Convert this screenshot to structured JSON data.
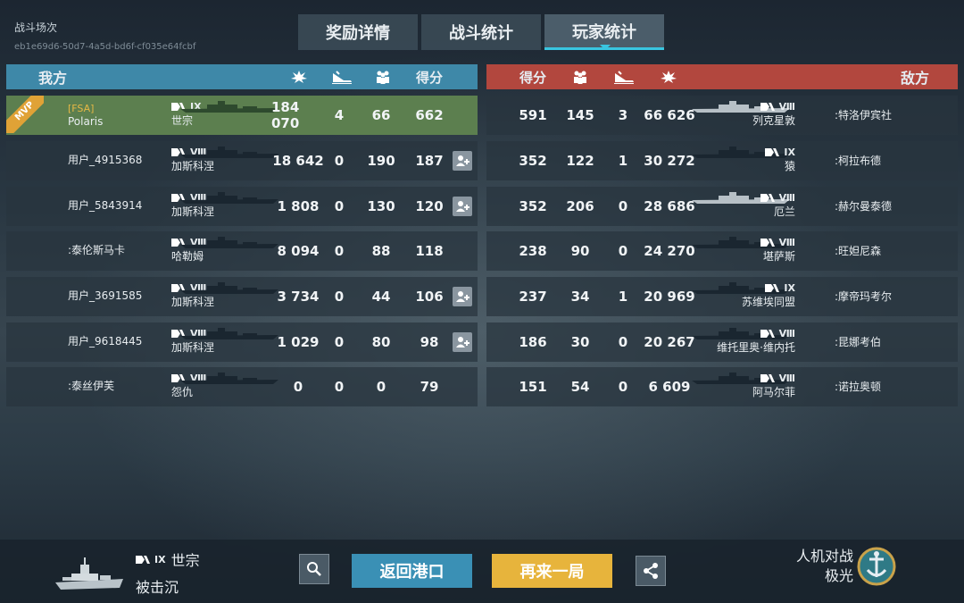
{
  "header": {
    "battle_label": "战斗场次",
    "battle_id": "eb1e69d6-50d7-4a5d-bd6f-cf035e64fcbf"
  },
  "tabs": [
    {
      "label": "奖励详情",
      "active": false
    },
    {
      "label": "战斗统计",
      "active": false
    },
    {
      "label": "玩家统计",
      "active": true
    }
  ],
  "ally": {
    "title": "我方",
    "score_header": "得分",
    "rows": [
      {
        "clan": "[FSA]",
        "name": "Polaris",
        "tier": "IX",
        "ship": "世宗",
        "damage": "184 070",
        "kills": "4",
        "xp": "66",
        "score": "662",
        "mvp": true,
        "mvp_label": "MVP",
        "add_friend": false
      },
      {
        "clan": "",
        "name": "用户_4915368",
        "tier": "Ⅷ",
        "ship": "加斯科涅",
        "damage": "18 642",
        "kills": "0",
        "xp": "190",
        "score": "187",
        "mvp": false,
        "add_friend": true
      },
      {
        "clan": "",
        "name": "用户_5843914",
        "tier": "Ⅷ",
        "ship": "加斯科涅",
        "damage": "1 808",
        "kills": "0",
        "xp": "130",
        "score": "120",
        "mvp": false,
        "add_friend": true
      },
      {
        "clan": "",
        "name": ":泰伦斯马卡",
        "tier": "Ⅷ",
        "ship": "哈勒姆",
        "damage": "8 094",
        "kills": "0",
        "xp": "88",
        "score": "118",
        "mvp": false,
        "add_friend": false
      },
      {
        "clan": "",
        "name": "用户_3691585",
        "tier": "Ⅷ",
        "ship": "加斯科涅",
        "damage": "3 734",
        "kills": "0",
        "xp": "44",
        "score": "106",
        "mvp": false,
        "add_friend": true
      },
      {
        "clan": "",
        "name": "用户_9618445",
        "tier": "Ⅷ",
        "ship": "加斯科涅",
        "damage": "1 029",
        "kills": "0",
        "xp": "80",
        "score": "98",
        "mvp": false,
        "add_friend": true
      },
      {
        "clan": "",
        "name": ":泰丝伊芙",
        "tier": "Ⅷ",
        "ship": "怨仇",
        "damage": "0",
        "kills": "0",
        "xp": "0",
        "score": "79",
        "mvp": false,
        "add_friend": false
      }
    ]
  },
  "enemy": {
    "title": "敌方",
    "score_header": "得分",
    "rows": [
      {
        "name": ":特洛伊宾社",
        "tier": "Ⅷ",
        "ship": "列克星敦",
        "damage": "66 626",
        "kills": "3",
        "xp": "145",
        "score": "591"
      },
      {
        "name": ":柯拉布德",
        "tier": "IX",
        "ship": "猿",
        "damage": "30 272",
        "kills": "1",
        "xp": "122",
        "score": "352"
      },
      {
        "name": ":赫尔曼泰德",
        "tier": "Ⅷ",
        "ship": "厄兰",
        "damage": "28 686",
        "kills": "0",
        "xp": "206",
        "score": "352"
      },
      {
        "name": ":旺妲尼森",
        "tier": "Ⅷ",
        "ship": "堪萨斯",
        "damage": "24 270",
        "kills": "0",
        "xp": "90",
        "score": "238"
      },
      {
        "name": ":摩帝玛考尔",
        "tier": "IX",
        "ship": "苏维埃同盟",
        "damage": "20 969",
        "kills": "1",
        "xp": "34",
        "score": "237"
      },
      {
        "name": ":昆娜考伯",
        "tier": "Ⅷ",
        "ship": "维托里奥·维内托",
        "damage": "20 267",
        "kills": "0",
        "xp": "30",
        "score": "186"
      },
      {
        "name": ":诺拉奥顿",
        "tier": "Ⅷ",
        "ship": "阿马尔菲",
        "damage": "6 609",
        "kills": "0",
        "xp": "54",
        "score": "151"
      }
    ]
  },
  "footer": {
    "tier": "IX",
    "ship": "世宗",
    "status": "被击沉",
    "port_button": "返回港口",
    "again_button": "再来一局",
    "mode": "人机对战",
    "map": "极光"
  },
  "colors": {
    "ally": "#3e88a8",
    "enemy": "#b2473e",
    "mvp_row": "#5c7f4f",
    "mvp_ribbon": "#e0a236",
    "port_button": "#3a90b5",
    "again_button": "#e7b43c",
    "tab_active_underline": "#39c5e0"
  },
  "icons": {
    "damage": "explosion-icon",
    "kills": "sinking-ship-icon",
    "xp": "crew-icon",
    "add_friend": "add-friend-icon",
    "search": "search-icon",
    "share": "share-icon"
  }
}
